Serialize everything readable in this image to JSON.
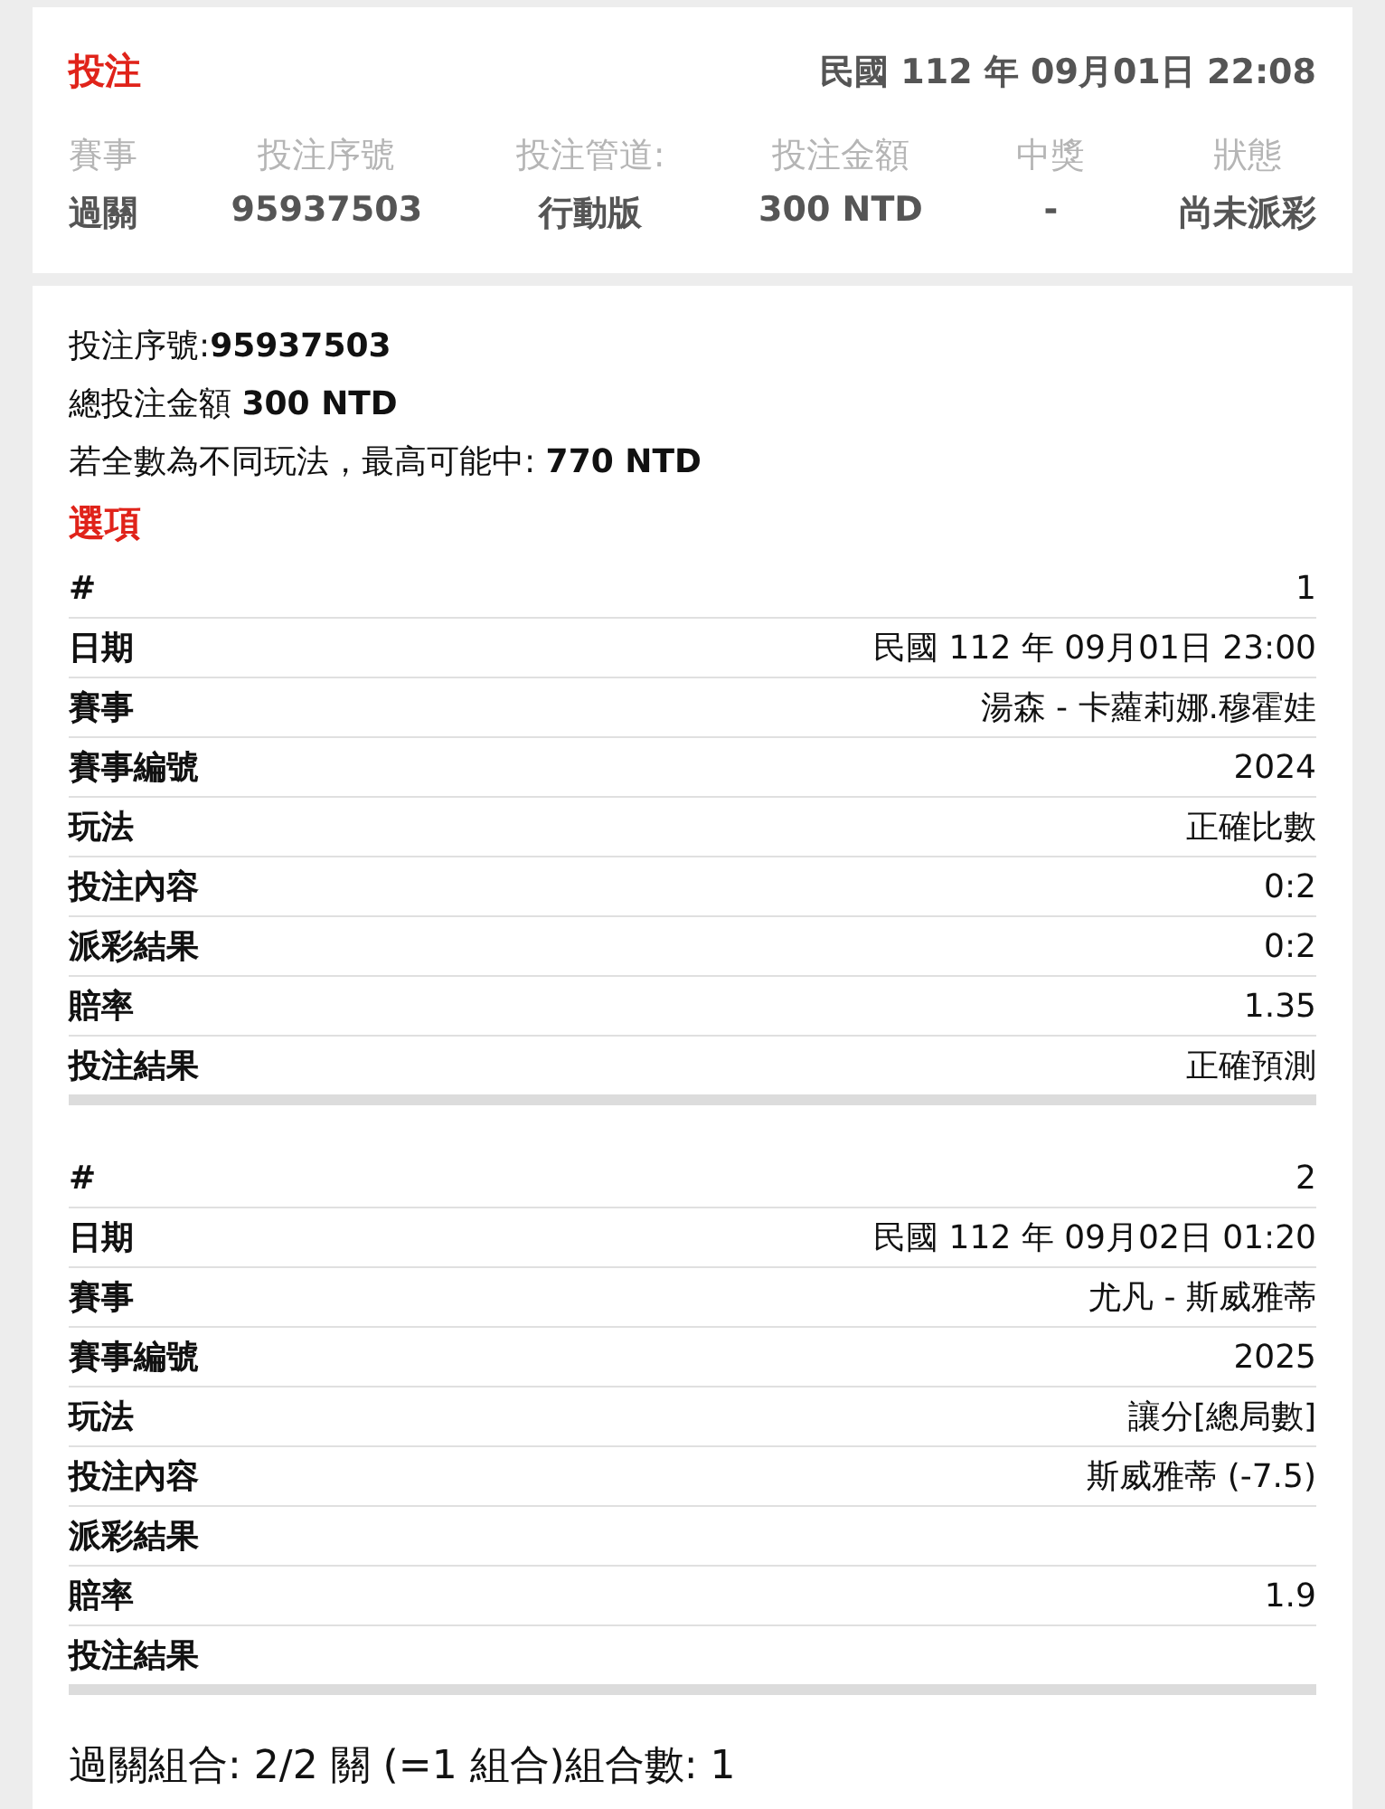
{
  "header": {
    "title": "投注",
    "datetime": "民國 112 年 09月01日 22:08",
    "columns": [
      {
        "label": "賽事",
        "value": "過關"
      },
      {
        "label": "投注序號",
        "value": "95937503"
      },
      {
        "label": "投注管道:",
        "value": "行動版"
      },
      {
        "label": "投注金額",
        "value": "300 NTD"
      },
      {
        "label": "中獎",
        "value": "-"
      },
      {
        "label": "狀態",
        "value": "尚未派彩"
      }
    ]
  },
  "summary": [
    "投注序號:**95937503**",
    "總投注金額 **300 NTD**",
    "若全數為不同玩法，最高可能中: **770 NTD**"
  ],
  "selections_title": "選項",
  "selections": [
    {
      "rows": [
        {
          "label": "#",
          "value": "1"
        },
        {
          "label": "日期",
          "value": "民國 112 年 09月01日 23:00"
        },
        {
          "label": "賽事",
          "value": "湯森 - 卡蘿莉娜.穆霍娃"
        },
        {
          "label": "賽事編號",
          "value": "2024"
        },
        {
          "label": "玩法",
          "value": "正確比數"
        },
        {
          "label": "投注內容",
          "value": "0:2"
        },
        {
          "label": "派彩結果",
          "value": "0:2"
        },
        {
          "label": "賠率",
          "value": "1.35"
        },
        {
          "label": "投注結果",
          "value": "正確預測"
        }
      ]
    },
    {
      "rows": [
        {
          "label": "#",
          "value": "2"
        },
        {
          "label": "日期",
          "value": "民國 112 年 09月02日 01:20"
        },
        {
          "label": "賽事",
          "value": "尤凡 - 斯威雅蒂"
        },
        {
          "label": "賽事編號",
          "value": "2025"
        },
        {
          "label": "玩法",
          "value": "讓分[總局數]"
        },
        {
          "label": "投注內容",
          "value": "斯威雅蒂 (-7.5)"
        },
        {
          "label": "派彩結果"
        },
        {
          "label": "賠率",
          "value": "1.9"
        },
        {
          "label": "投注結果"
        }
      ]
    }
  ],
  "footer": "過關組合: 2/2 關 (=1 組合)組合數: 1"
}
